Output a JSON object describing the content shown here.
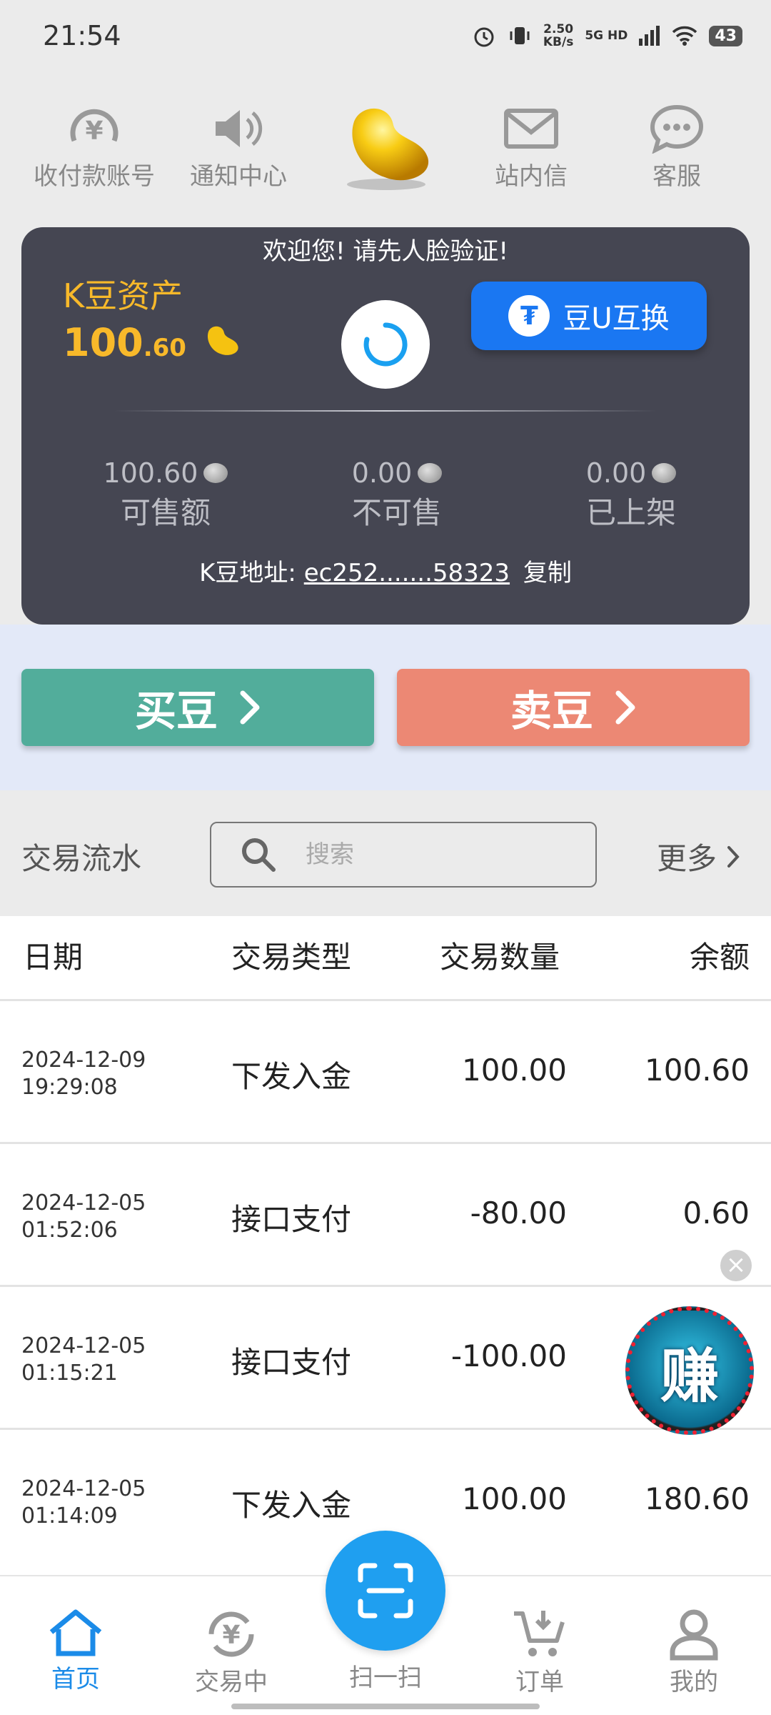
{
  "status_bar": {
    "time": "21:54",
    "net_speed_top": "2.50",
    "net_speed_bottom": "KB/s",
    "network": "5G HD",
    "battery": "43"
  },
  "shortcuts": [
    {
      "label": "收付款账号",
      "icon": "yen-circle-icon"
    },
    {
      "label": "通知中心",
      "icon": "speaker-icon"
    },
    {
      "label": "",
      "icon": "gold-bean-icon"
    },
    {
      "label": "站内信",
      "icon": "envelope-icon"
    },
    {
      "label": "客服",
      "icon": "chat-bubble-icon"
    }
  ],
  "asset_card": {
    "welcome": "欢迎您! 请先人脸验证!",
    "title": "K豆资产",
    "value_int": "100",
    "value_dec": ".60",
    "exchange_label": "豆U互换",
    "stats": [
      {
        "value": "100.60",
        "label": "可售额"
      },
      {
        "value": "0.00",
        "label": "不可售"
      },
      {
        "value": "0.00",
        "label": "已上架"
      }
    ],
    "address_label": "K豆地址:",
    "address_value": "ec252.......58323",
    "copy_label": "复制"
  },
  "actions": {
    "buy_label": "买豆",
    "sell_label": "卖豆"
  },
  "ledger": {
    "title": "交易流水",
    "search_placeholder": "搜索",
    "more_label": "更多",
    "columns": [
      "日期",
      "交易类型",
      "交易数量",
      "余额"
    ],
    "rows": [
      {
        "date": "2024-12-09",
        "time": "19:29:08",
        "type": "下发入金",
        "amount": "100.00",
        "balance": "100.60"
      },
      {
        "date": "2024-12-05",
        "time": "01:52:06",
        "type": "接口支付",
        "amount": "-80.00",
        "balance": "0.60"
      },
      {
        "date": "2024-12-05",
        "time": "01:15:21",
        "type": "接口支付",
        "amount": "-100.00",
        "balance": ""
      },
      {
        "date": "2024-12-05",
        "time": "01:14:09",
        "type": "下发入金",
        "amount": "100.00",
        "balance": "180.60"
      }
    ]
  },
  "earn_badge": {
    "label": "赚",
    "close": "×"
  },
  "bottom_nav": [
    {
      "label": "首页"
    },
    {
      "label": "交易中"
    },
    {
      "label": "扫一扫"
    },
    {
      "label": "订单"
    },
    {
      "label": "我的"
    }
  ],
  "colors": {
    "accent": "#1b8be8",
    "gold": "#f8b92a",
    "buy": "#52ad9b",
    "sell": "#ec8874",
    "card": "#454652"
  }
}
